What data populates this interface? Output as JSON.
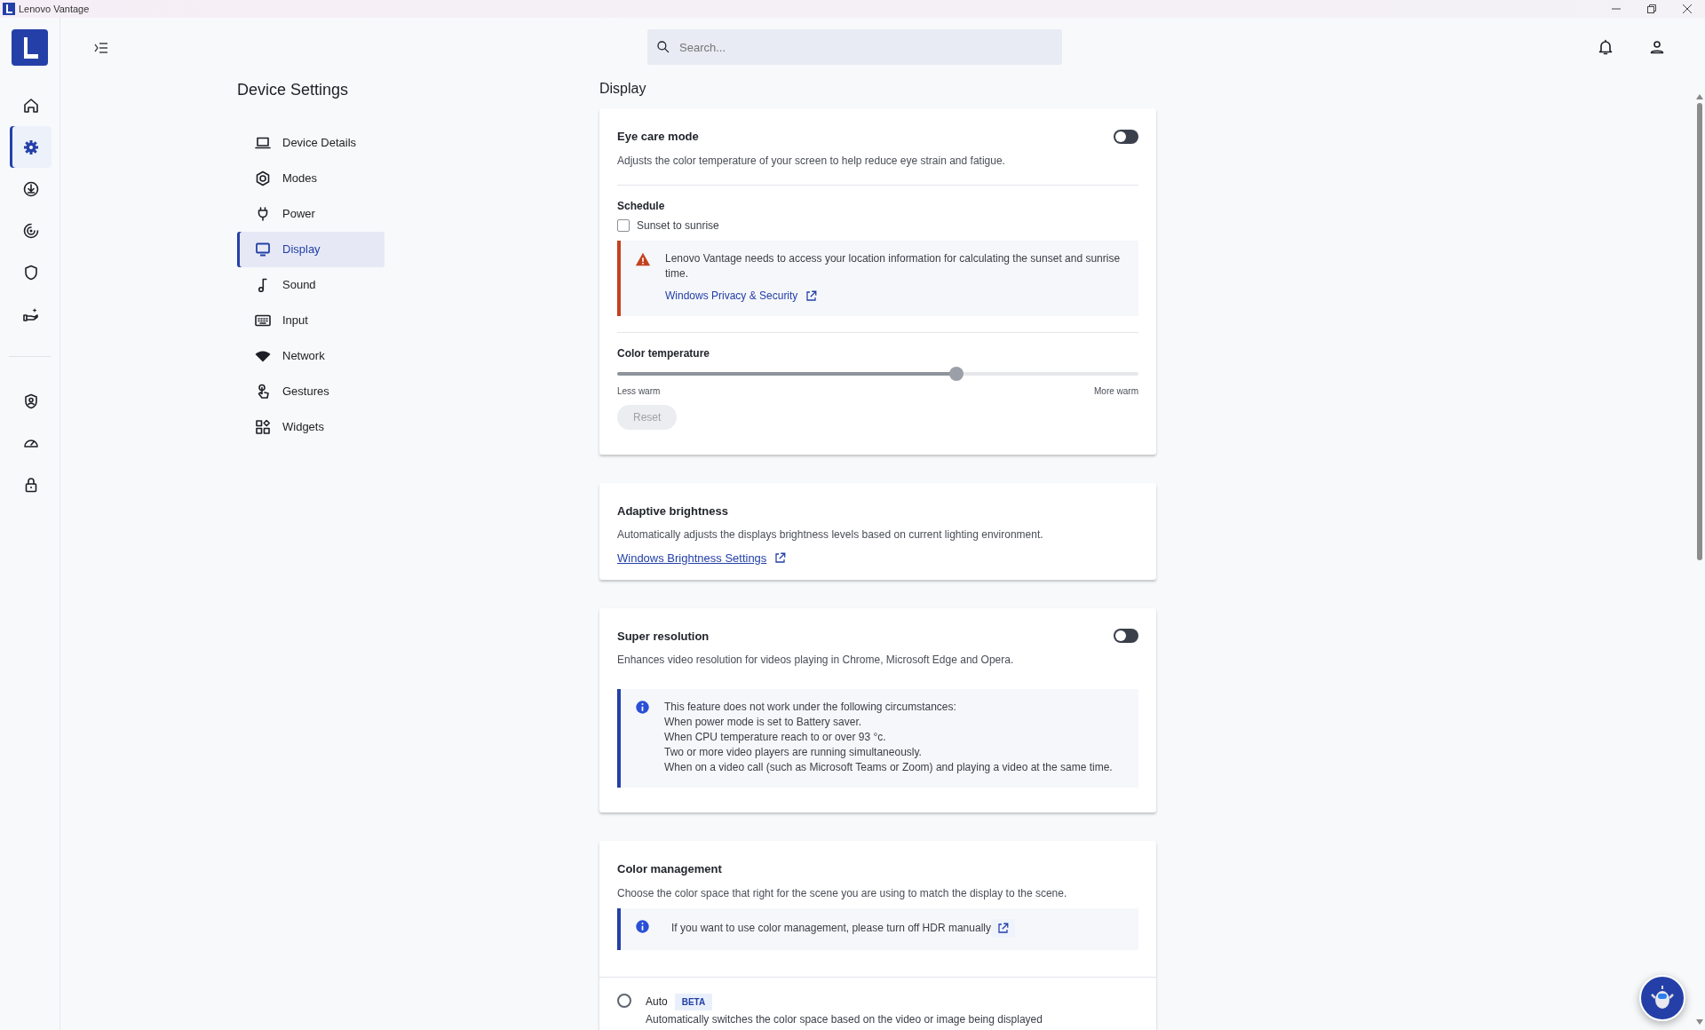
{
  "window": {
    "title": "Lenovo Vantage"
  },
  "rail": {
    "top": [
      {
        "selected": false
      },
      {
        "selected": true
      },
      {
        "selected": false
      },
      {
        "selected": false
      },
      {
        "selected": false
      },
      {
        "selected": false
      }
    ],
    "bottom": [
      {
        "selected": false
      },
      {
        "selected": false
      },
      {
        "selected": false
      }
    ]
  },
  "search": {
    "placeholder": "Search..."
  },
  "settings_nav": {
    "title": "Device Settings",
    "items": [
      {
        "label": "Device Details",
        "selected": false
      },
      {
        "label": "Modes",
        "selected": false
      },
      {
        "label": "Power",
        "selected": false
      },
      {
        "label": "Display",
        "selected": true
      },
      {
        "label": "Sound",
        "selected": false
      },
      {
        "label": "Input",
        "selected": false
      },
      {
        "label": "Network",
        "selected": false
      },
      {
        "label": "Gestures",
        "selected": false
      },
      {
        "label": "Widgets",
        "selected": false
      }
    ]
  },
  "section_title": "Display",
  "cards": [
    {
      "title": "Eye care mode",
      "on": false,
      "description": "Adjusts the color temperature of your screen to help reduce eye strain and fatigue.",
      "schedule": {
        "heading": "Schedule",
        "option": {
          "label": "Sunset to sunrise",
          "checked": false
        },
        "alert": {
          "kind": "warning",
          "lines": [
            "Lenovo Vantage needs to access your location information for calculating the sunset and sunrise time."
          ],
          "link": "Windows Privacy & Security"
        }
      },
      "temperature": {
        "heading": "Color temperature",
        "level": 0.65,
        "min_label": "Less warm",
        "max_label": "More warm",
        "reset": {
          "label": "Reset",
          "disabled": true
        }
      }
    },
    {
      "title": "Adaptive brightness",
      "description": "Automatically adjusts the displays brightness levels based on current lighting environment.",
      "link": "Windows Brightness Settings"
    },
    {
      "title": "Super resolution",
      "on": false,
      "description": "Enhances video resolution for videos playing in Chrome, Microsoft Edge and Opera.",
      "alert": {
        "kind": "info",
        "lines": [
          "This feature does not work under the following circumstances:",
          "When power mode is set to Battery saver.",
          "When CPU temperature reach to or over 93 °c.",
          "Two or more video players are running simultaneously.",
          "When on a video call (such as Microsoft Teams or Zoom) and playing a video at the same time."
        ]
      }
    },
    {
      "title": "Color management",
      "description": "Choose the color space that right for the scene you are using to match the display to the scene.",
      "alert": {
        "kind": "info",
        "lines": [
          "If you want to use color management, please turn off HDR manually"
        ],
        "external_button": true
      },
      "options": [
        {
          "label": "Auto",
          "badge": "BETA",
          "description": "Automatically switches the color space based on the video or image being displayed",
          "selected": false
        }
      ]
    }
  ]
}
